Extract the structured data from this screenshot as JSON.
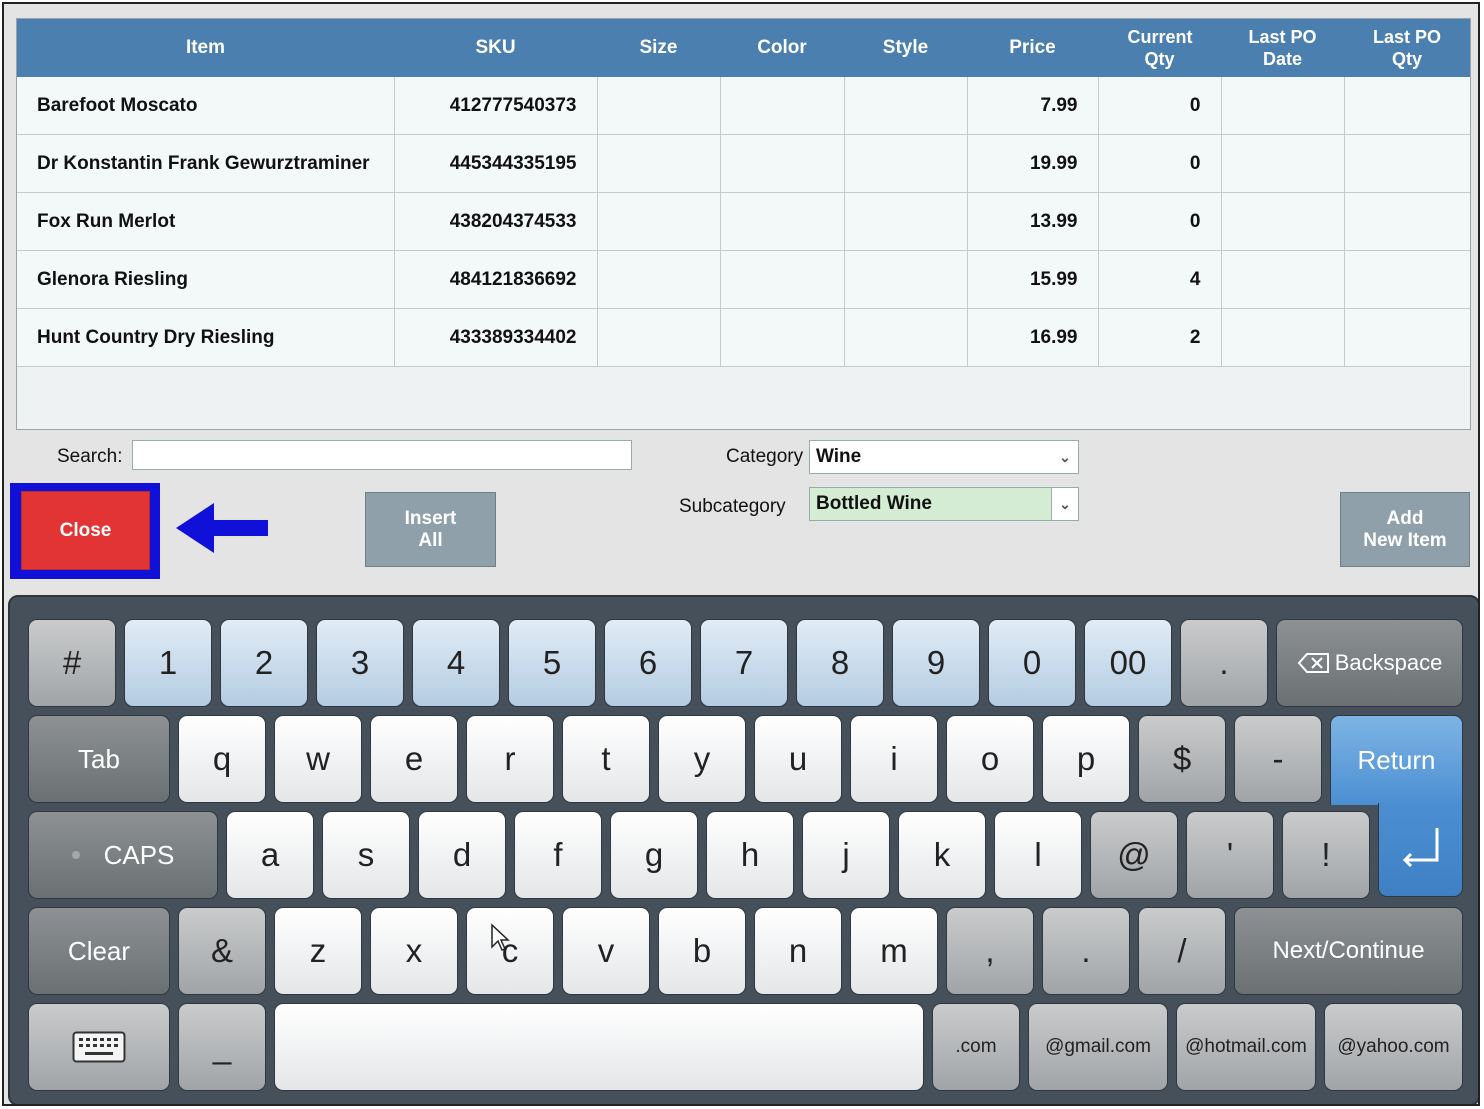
{
  "table": {
    "headers": [
      "Item",
      "SKU",
      "Size",
      "Color",
      "Style",
      "Price",
      "Current Qty",
      "Last PO Date",
      "Last PO Qty"
    ],
    "rows": [
      [
        "Barefoot Moscato",
        "412777540373",
        "",
        "",
        "",
        "7.99",
        "0",
        "",
        ""
      ],
      [
        "Dr Konstantin Frank Gewurztraminer",
        "445344335195",
        "",
        "",
        "",
        "19.99",
        "0",
        "",
        ""
      ],
      [
        "Fox Run Merlot",
        "438204374533",
        "",
        "",
        "",
        "13.99",
        "0",
        "",
        ""
      ],
      [
        "Glenora Riesling",
        "484121836692",
        "",
        "",
        "",
        "15.99",
        "4",
        "",
        ""
      ],
      [
        "Hunt Country Dry Riesling",
        "433389334402",
        "",
        "",
        "",
        "16.99",
        "2",
        "",
        ""
      ]
    ]
  },
  "search": {
    "label": "Search:",
    "value": ""
  },
  "category": {
    "label": "Category",
    "value": "Wine"
  },
  "subcategory": {
    "label": "Subcategory",
    "value": "Bottled Wine"
  },
  "buttons": {
    "close": "Close",
    "insert_all_line1": "Insert",
    "insert_all_line2": "All",
    "add_new_line1": "Add",
    "add_new_line2": "New Item"
  },
  "keyboard": {
    "row1": [
      "#",
      "1",
      "2",
      "3",
      "4",
      "5",
      "6",
      "7",
      "8",
      "9",
      "0",
      "00",
      "."
    ],
    "backspace": "Backspace",
    "tab": "Tab",
    "row2": [
      "q",
      "w",
      "e",
      "r",
      "t",
      "y",
      "u",
      "i",
      "o",
      "p",
      "$",
      "-"
    ],
    "return": "Return",
    "caps": "CAPS",
    "row3": [
      "a",
      "s",
      "d",
      "f",
      "g",
      "h",
      "j",
      "k",
      "l",
      "@",
      "'",
      "!"
    ],
    "clear": "Clear",
    "row4": [
      "&",
      "z",
      "x",
      "c",
      "v",
      "b",
      "n",
      "m",
      ",",
      ".",
      "/"
    ],
    "next": "Next/Continue",
    "underscore": "_",
    "shortcuts": [
      ".com",
      "@gmail.com",
      "@hotmail.com",
      "@yahoo.com"
    ]
  },
  "colors": {
    "header_blue": "#4a7fb0",
    "close_red": "#e23434",
    "highlight_blue": "#1010d8",
    "subcategory_bg": "#d4ecd4",
    "return_blue": "#4b8fd2"
  }
}
